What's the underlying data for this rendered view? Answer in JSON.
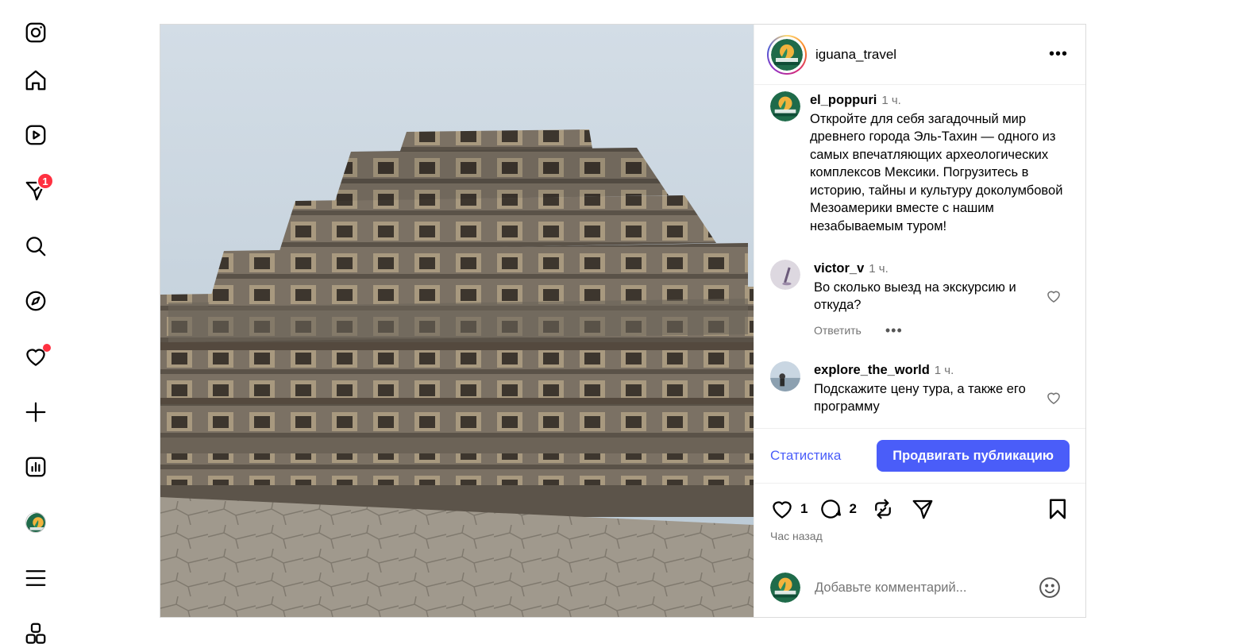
{
  "nav": {
    "items": [
      {
        "name": "instagram-logo-icon"
      },
      {
        "name": "home-icon"
      },
      {
        "name": "reels-icon"
      },
      {
        "name": "direct-messages-icon",
        "badge": "1"
      },
      {
        "name": "search-icon"
      },
      {
        "name": "explore-icon"
      },
      {
        "name": "notifications-heart-icon"
      },
      {
        "name": "create-icon"
      },
      {
        "name": "dashboard-icon"
      },
      {
        "name": "profile-avatar"
      },
      {
        "name": "menu-icon"
      },
      {
        "name": "threads-icon"
      }
    ]
  },
  "post": {
    "author": "iguana_travel",
    "caption": {
      "username": "el_poppuri",
      "time": "1 ч.",
      "text": "Откройте для себя загадочный мир древнего города Эль-Тахин — одного из самых впечатляющих археологических комплексов Мексики. Погрузитесь в историю, тайны и культуру доколумбовой Мезоамерики вместе с нашим незабываемым туром!"
    },
    "comments": [
      {
        "username": "victor_v",
        "time": "1 ч.",
        "text": "Во сколько выезд на экскурсию и откуда?",
        "reply": "Ответить"
      },
      {
        "username": "explore_the_world",
        "time": "1 ч.",
        "text": "Подскажите цену тура, а также его программу"
      }
    ],
    "promo": {
      "stats_label": "Статистика",
      "boost_label": "Продвигать публикацию"
    },
    "likes_count": "1",
    "comments_count": "2",
    "posted_label": "Час назад",
    "add_comment_placeholder": "Добавьте комментарий..."
  },
  "colors": {
    "accent": "#4a5df9",
    "badge": "#ff3040",
    "muted": "#737373"
  }
}
